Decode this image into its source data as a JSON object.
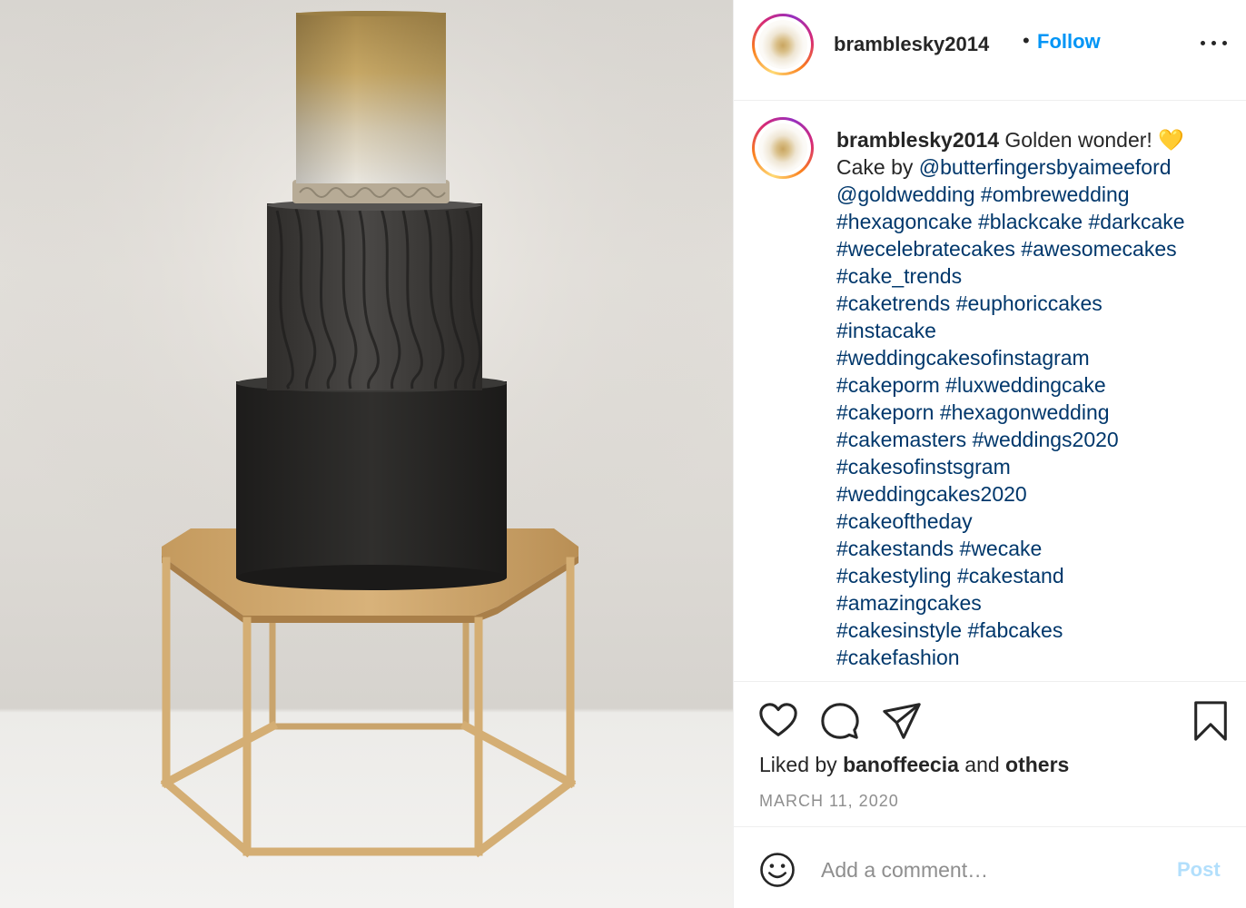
{
  "post": {
    "image_alt": "Three-tier black and gold cake on a hexagonal gold stand"
  },
  "header": {
    "username": "bramblesky2014",
    "separator": "•",
    "follow_label": "Follow",
    "more_icon": "more-options-icon"
  },
  "caption": {
    "author": "bramblesky2014",
    "lines": [
      [
        {
          "t": "text",
          "v": " Golden wonder! 💛"
        }
      ],
      [
        {
          "t": "text",
          "v": "Cake by "
        },
        {
          "t": "link",
          "v": "@butterfingersbyaimeeford"
        }
      ],
      [
        {
          "t": "link",
          "v": "@goldwedding"
        },
        {
          "t": "text",
          "v": " "
        },
        {
          "t": "link",
          "v": "#ombrewedding"
        }
      ],
      [
        {
          "t": "link",
          "v": "#hexagoncake"
        },
        {
          "t": "text",
          "v": " "
        },
        {
          "t": "link",
          "v": "#blackcake"
        },
        {
          "t": "text",
          "v": " "
        },
        {
          "t": "link",
          "v": "#darkcake"
        }
      ],
      [
        {
          "t": "link",
          "v": "#wecelebratecakes"
        },
        {
          "t": "text",
          "v": " "
        },
        {
          "t": "link",
          "v": "#awesomecakes"
        }
      ],
      [
        {
          "t": "link",
          "v": "#cake_trends"
        }
      ],
      [
        {
          "t": "link",
          "v": "#caketrends"
        },
        {
          "t": "text",
          "v": " "
        },
        {
          "t": "link",
          "v": "#euphoriccakes"
        }
      ],
      [
        {
          "t": "link",
          "v": "#instacake"
        }
      ],
      [
        {
          "t": "link",
          "v": "#weddingcakesofinstagram"
        }
      ],
      [
        {
          "t": "link",
          "v": "#cakeporm"
        },
        {
          "t": "text",
          "v": " "
        },
        {
          "t": "link",
          "v": "#luxweddingcake"
        }
      ],
      [
        {
          "t": "link",
          "v": "#cakeporn"
        },
        {
          "t": "text",
          "v": " "
        },
        {
          "t": "link",
          "v": "#hexagonwedding"
        }
      ],
      [
        {
          "t": "link",
          "v": "#cakemasters"
        },
        {
          "t": "text",
          "v": " "
        },
        {
          "t": "link",
          "v": "#weddings2020"
        }
      ],
      [
        {
          "t": "link",
          "v": "#cakesofinstsgram"
        }
      ],
      [
        {
          "t": "link",
          "v": "#weddingcakes2020"
        }
      ],
      [
        {
          "t": "link",
          "v": "#cakeoftheday"
        }
      ],
      [
        {
          "t": "link",
          "v": "#cakestands"
        },
        {
          "t": "text",
          "v": " "
        },
        {
          "t": "link",
          "v": "#wecake"
        }
      ],
      [
        {
          "t": "link",
          "v": "#cakestyling"
        },
        {
          "t": "text",
          "v": " "
        },
        {
          "t": "link",
          "v": "#cakestand"
        }
      ],
      [
        {
          "t": "link",
          "v": "#amazingcakes"
        }
      ],
      [
        {
          "t": "link",
          "v": "#cakesinstyle"
        },
        {
          "t": "text",
          "v": " "
        },
        {
          "t": "link",
          "v": "#fabcakes"
        }
      ],
      [
        {
          "t": "link",
          "v": "#cakefashion"
        }
      ]
    ]
  },
  "actions": {
    "icons": [
      "heart-icon",
      "comment-icon",
      "share-icon",
      "bookmark-icon"
    ],
    "liked_by_prefix": "Liked by ",
    "liked_by_user": "banoffeecia",
    "liked_by_middle": " and ",
    "liked_by_suffix": "others",
    "date": "MARCH 11, 2020"
  },
  "comment": {
    "placeholder": "Add a comment…",
    "post_label": "Post",
    "emoji_icon": "emoji-icon"
  },
  "colors": {
    "follow": "#0095f6",
    "link": "#00376b",
    "post_disabled": "#b2dffc",
    "muted": "#8e8e8e"
  }
}
